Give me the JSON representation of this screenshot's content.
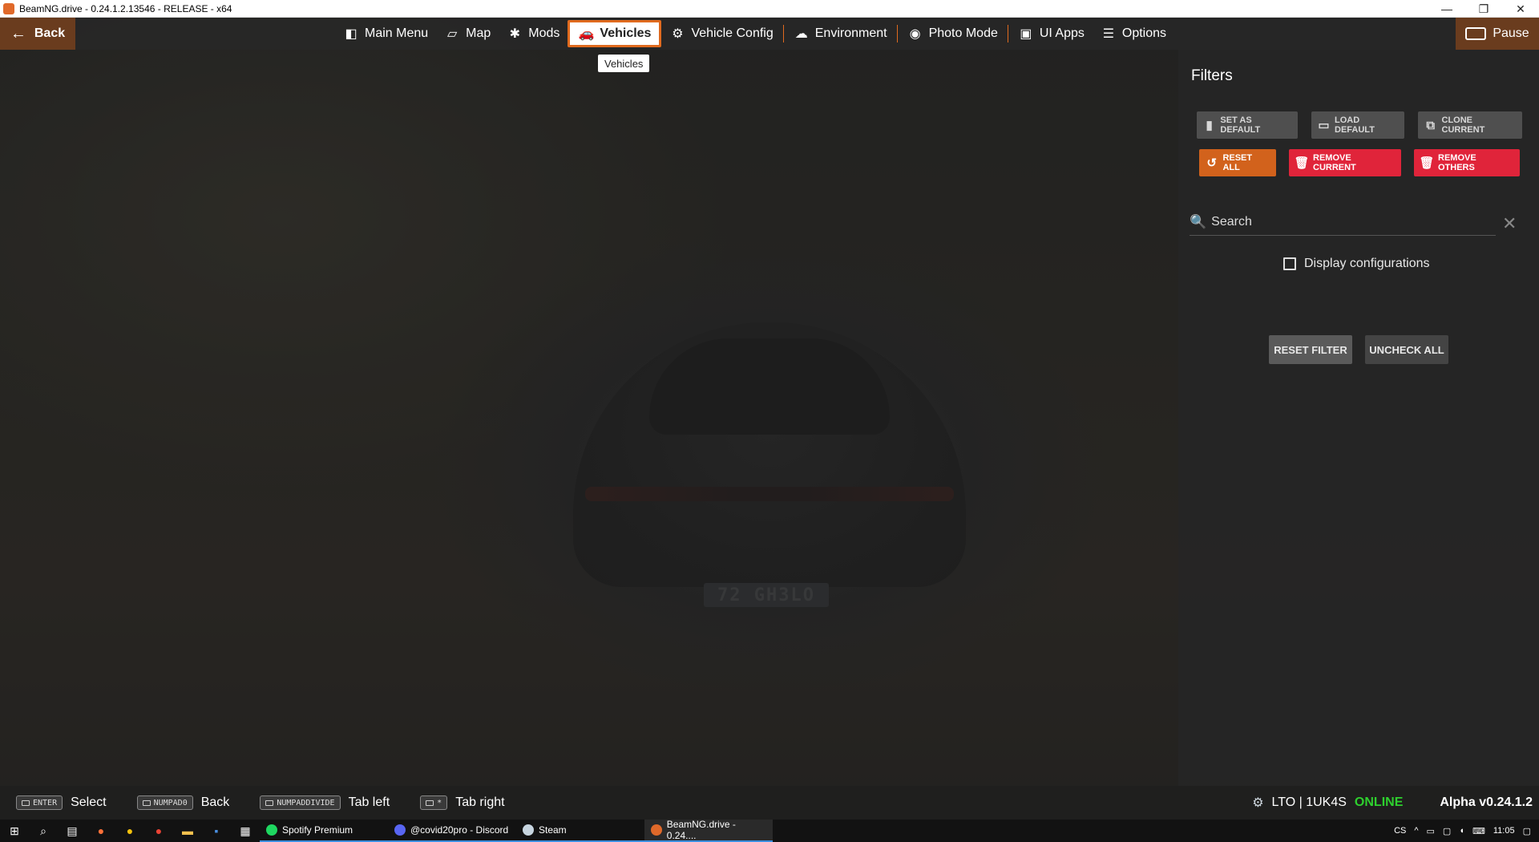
{
  "window": {
    "title": "BeamNG.drive - 0.24.1.2.13546 - RELEASE - x64",
    "controls": {
      "minimize": "—",
      "restore": "❐",
      "close": "✕"
    }
  },
  "scene": {
    "plate_text": "72 GH3LO"
  },
  "topbar": {
    "back_label": "Back",
    "pause_label": "Pause",
    "menu": [
      {
        "label": "Main Menu",
        "icon": "main-menu-icon",
        "glyph": "◧"
      },
      {
        "label": "Map",
        "icon": "map-icon",
        "glyph": "▱"
      },
      {
        "label": "Mods",
        "icon": "puzzle-icon",
        "glyph": "✱"
      },
      {
        "label": "Vehicles",
        "icon": "car-icon",
        "glyph": "🚗",
        "active": true
      },
      {
        "label": "Vehicle Config",
        "icon": "engine-icon",
        "glyph": "⚙"
      },
      {
        "label": "Environment",
        "icon": "weather-icon",
        "glyph": "☁"
      },
      {
        "label": "Photo Mode",
        "icon": "camera-icon",
        "glyph": "◉"
      },
      {
        "label": "UI Apps",
        "icon": "ui-apps-icon",
        "glyph": "▣"
      },
      {
        "label": "Options",
        "icon": "sliders-icon",
        "glyph": "☰"
      }
    ],
    "tooltip": "Vehicles",
    "accent": "#e06a1e"
  },
  "filters": {
    "title": "Filters",
    "buttons": {
      "set_default": "SET AS DEFAULT",
      "load_default": "LOAD DEFAULT",
      "clone_current": "CLONE CURRENT",
      "reset_all": "RESET ALL",
      "remove_current": "REMOVE CURRENT",
      "remove_others": "REMOVE OTHERS"
    },
    "search_placeholder": "Search",
    "display_configurations_label": "Display configurations",
    "display_configurations_checked": false,
    "reset_filter": "RESET FILTER",
    "uncheck_all": "UNCHECK ALL"
  },
  "hints": [
    {
      "key": "ENTER",
      "label": "Select"
    },
    {
      "key": "NUMPAD0",
      "label": "Back"
    },
    {
      "key": "NUMPADDIVIDE",
      "label": "Tab left"
    },
    {
      "key": "*",
      "label": "Tab right"
    }
  ],
  "status": {
    "user": "LTO | 1UK4S",
    "online": "ONLINE",
    "version": "Alpha v0.24.1.2"
  },
  "taskbar": {
    "tasks": [
      {
        "label": "Spotify Premium",
        "color": "#1ed760"
      },
      {
        "label": "@covid20pro - Discord",
        "color": "#5865f2"
      },
      {
        "label": "Steam",
        "color": "#1b2838"
      },
      {
        "label": "BeamNG.drive - 0.24....",
        "color": "#e0692a"
      }
    ],
    "lang": "CS",
    "time": "11:05"
  }
}
